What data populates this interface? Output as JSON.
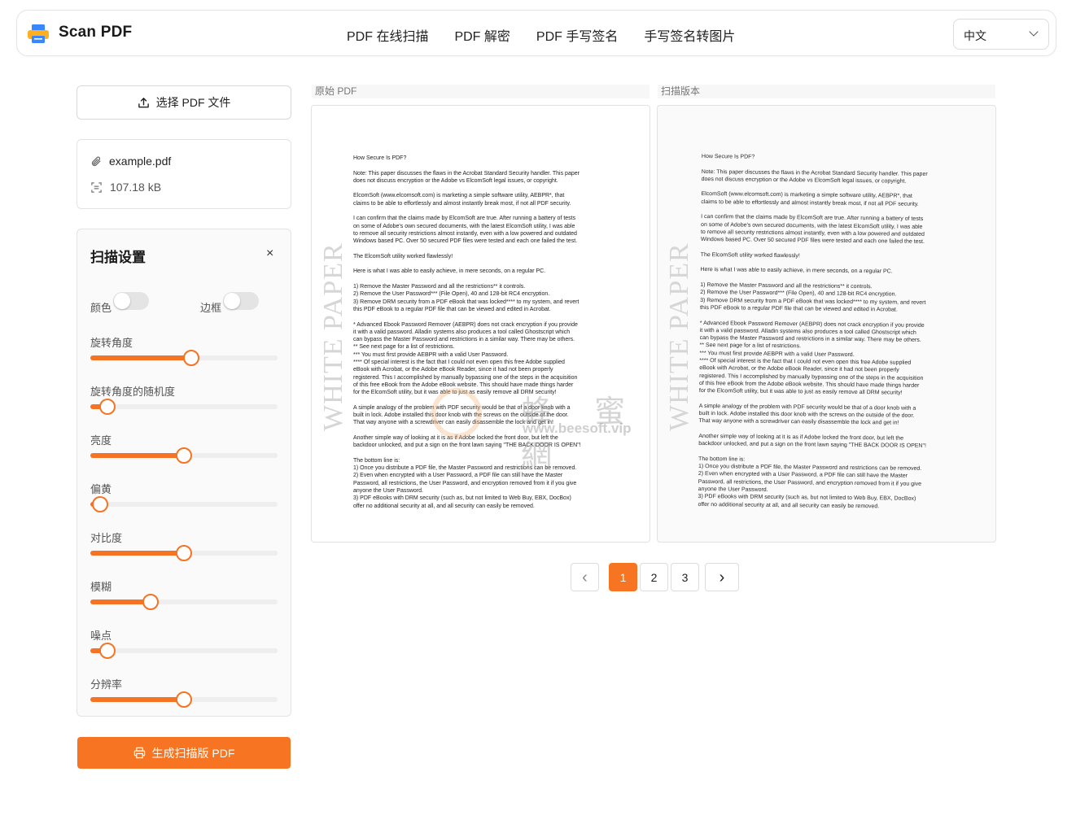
{
  "header": {
    "brand": "Scan PDF",
    "nav": [
      "PDF 在线扫描",
      "PDF 解密",
      "PDF 手写签名",
      "手写签名转图片"
    ],
    "language": "中文"
  },
  "left": {
    "select_button": "选择 PDF 文件",
    "file": {
      "name": "example.pdf",
      "size": "107.18 kB"
    },
    "settings": {
      "title": "扫描设置",
      "close": "×",
      "toggles": [
        {
          "label": "颜色",
          "on": false
        },
        {
          "label": "边框",
          "on": false
        }
      ],
      "sliders": [
        {
          "label": "旋转角度",
          "value": 0.54
        },
        {
          "label": "旋转角度的随机度",
          "value": 0.09
        },
        {
          "label": "亮度",
          "value": 0.5
        },
        {
          "label": "偏黄",
          "value": 0.05
        },
        {
          "label": "对比度",
          "value": 0.5
        },
        {
          "label": "模糊",
          "value": 0.32
        },
        {
          "label": "噪点",
          "value": 0.09
        },
        {
          "label": "分辨率",
          "value": 0.5
        }
      ]
    },
    "generate_button": "生成扫描版 PDF"
  },
  "preview": {
    "original_label": "原始 PDF",
    "scanned_label": "扫描版本",
    "watermark": "WHITE PAPER",
    "document": [
      "How Secure Is PDF?",
      "Note: This paper discusses the flaws in the Acrobat Standard Security handler. This paper\ndoes not discuss encryption or the Adobe vs ElcomSoft legal issues, or copyright.",
      "ElcomSoft (www.elcomsoft.com) is marketing a simple software utility, AEBPR*, that\nclaims to be able to effortlessly and almost instantly break most, if not all PDF security.",
      "I can confirm that the claims made by ElcomSoft are true. After running a battery of tests\non some of Adobe's own secured documents, with the latest ElcomSoft utility, I was able\nto remove all security restrictions almost instantly, even with a low powered and outdated\nWindows based PC. Over 50 secured PDF files were tested and each one failed the test.",
      "The ElcomSoft utility worked flawlessly!",
      "Here is what I was able to easily achieve, in mere seconds, on a regular PC.",
      "1) Remove the Master Password and all the restrictions** it controls.\n2) Remove the User Password*** (File Open), 40 and 128-bit RC4 encryption.\n3) Remove DRM security from a PDF eBook that was locked**** to my system, and revert\nthis PDF eBook to a regular PDF file that can be viewed and edited in Acrobat.",
      "* Advanced Ebook Password Remover (AEBPR) does not crack encryption if you provide\nit with a valid password. Alladin systems also produces a tool called Ghostscript which\ncan bypass the Master Password and restrictions in a similar way. There may be others.\n** See next page for a list of restrictions.\n*** You must first provide AEBPR with a valid User Password.\n**** Of special interest is the fact that I could not even open this free Adobe supplied\neBook with Acrobat, or the Adobe eBook Reader, since it had not been properly\nregistered. This I accomplished by manually bypassing one of the steps in the acquisition\nof this free eBook from the Adobe eBook website. This should have made things harder\nfor the ElcomSoft utility, but it was able to just as easily remove all DRM security!",
      "A simple analogy of the problem with PDF security would be that of a door knob with a\nbuilt in lock. Adobe installed this door knob with the screws on the outside of the door.\nThat way anyone with a screwdriver can easily disassemble the lock and get in!",
      "Another simple way of looking at it is as if Adobe locked the front door, but left the\nbackdoor unlocked, and put a sign on the front lawn saying \"THE BACK DOOR IS OPEN\"!",
      "The bottom line is:\n1) Once you distribute a PDF file, the Master Password and restrictions can be removed.\n2) Even when encrypted with a User Password, a PDF file can still have the Master\nPassword, all restrictions, the User Password, and encryption removed from it if you give\nanyone the User Password.\n3) PDF eBooks with DRM security (such as, but not limited to Web Buy, EBX, DocBox)\noffer no additional security at all, and all security can easily be removed."
    ],
    "overlay_watermark": {
      "cn": "蜂 蜜 網",
      "en": "www.beesoft.vip"
    }
  },
  "pagination": {
    "prev": "‹",
    "pages": [
      "1",
      "2",
      "3"
    ],
    "current": "1",
    "next": "›"
  }
}
